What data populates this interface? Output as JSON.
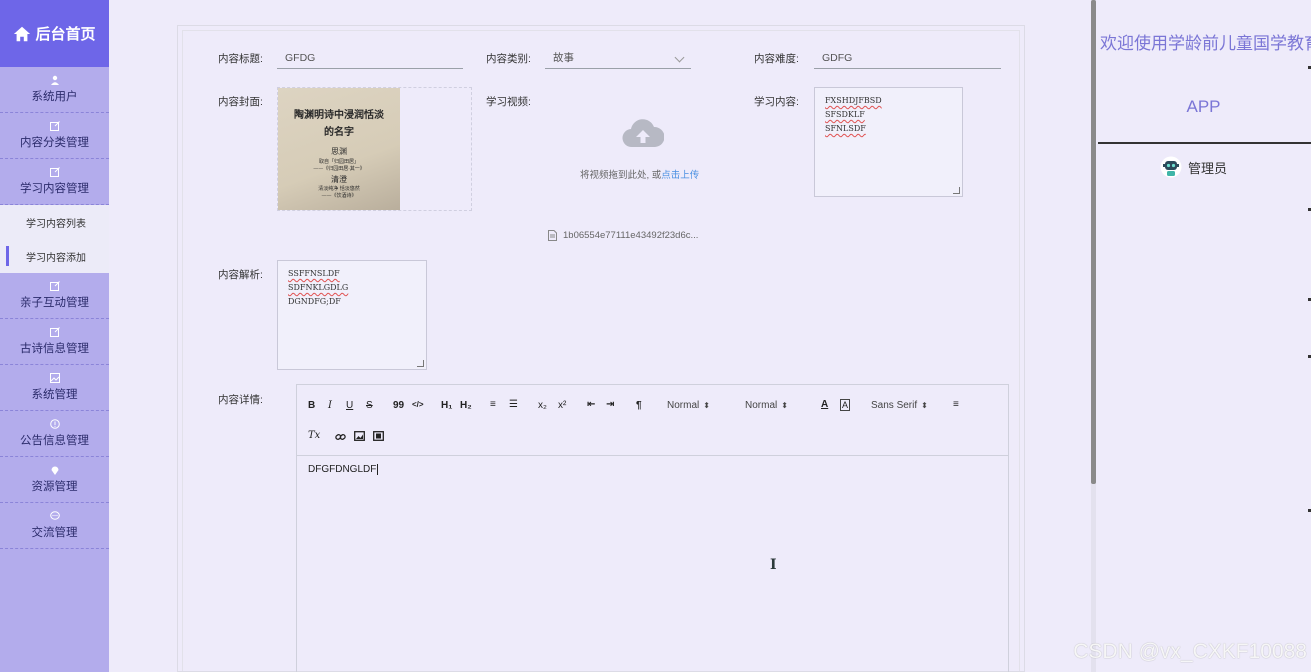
{
  "sidebar": {
    "brand": "后台首页",
    "items": [
      {
        "label": "系统用户",
        "icon": "user-icon"
      },
      {
        "label": "内容分类管理",
        "icon": "edit-icon"
      },
      {
        "label": "学习内容管理",
        "icon": "edit-icon"
      },
      {
        "label": "亲子互动管理",
        "icon": "edit-icon"
      },
      {
        "label": "古诗信息管理",
        "icon": "edit-icon"
      },
      {
        "label": "系统管理",
        "icon": "image-icon"
      },
      {
        "label": "公告信息管理",
        "icon": "info-icon"
      },
      {
        "label": "资源管理",
        "icon": "location-icon"
      },
      {
        "label": "交流管理",
        "icon": "chat-icon"
      }
    ],
    "subitems": [
      {
        "label": "学习内容列表"
      },
      {
        "label": "学习内容添加",
        "active": true
      }
    ]
  },
  "form": {
    "title_label": "内容标题:",
    "title_value": "GFDG",
    "category_label": "内容类别:",
    "category_value": "故事",
    "difficulty_label": "内容难度:",
    "difficulty_value": "GDFG",
    "cover_label": "内容封面:",
    "cover_text": {
      "title1": "陶渊明诗中浸润恬淡",
      "title2": "的名字",
      "name1": "思渊",
      "line1": "取自「归园田居」",
      "line2": "——《归园田居·其一》",
      "name2": "清澄",
      "line3": "清淡纯净 恬淡悠然",
      "line4": "——《饮酒诗》"
    },
    "video_label": "学习视频:",
    "upload_hint": "将视频拖到此处, 或",
    "upload_link": "点击上传",
    "uploaded_file": "1b06554e77111e43492f23d6c...",
    "content_label": "学习内容:",
    "content_lines": [
      "FXSHDJFBSD",
      "SFSDKLF",
      "SFNLSDF"
    ],
    "analysis_label": "内容解析:",
    "analysis_lines": [
      "SSFFNSLDF",
      "SDFNKLGDLG",
      "DGNDFG;DF"
    ],
    "detail_label": "内容详情:",
    "editor_text": "DFGFDNGLDF"
  },
  "editor_toolbar": {
    "bold": "B",
    "italic": "I",
    "underline": "U",
    "strike": "S",
    "quote": "99",
    "code": "</>",
    "h1": "H₁",
    "h2": "H₂",
    "ordered": "≡",
    "bullet": "☰",
    "sub": "x₂",
    "sup": "x²",
    "outdent": "⇤",
    "indent": "⇥",
    "rtl": "¶",
    "size_value": "Normal",
    "header_value": "Normal",
    "font_value": "Sans Serif",
    "clean": "Tx"
  },
  "header_panel": {
    "welcome": "欢迎使用学龄前儿童国学教育",
    "app": "APP",
    "user": "管理员"
  },
  "watermark": "CSDN @vx_CXKF10088",
  "colors": {
    "brand_bg": "#6e66e8",
    "sidebar_bg": "#b3acec",
    "page_bg": "#eeebfa",
    "link": "#4a90e2",
    "header_text": "#7b76d6"
  }
}
